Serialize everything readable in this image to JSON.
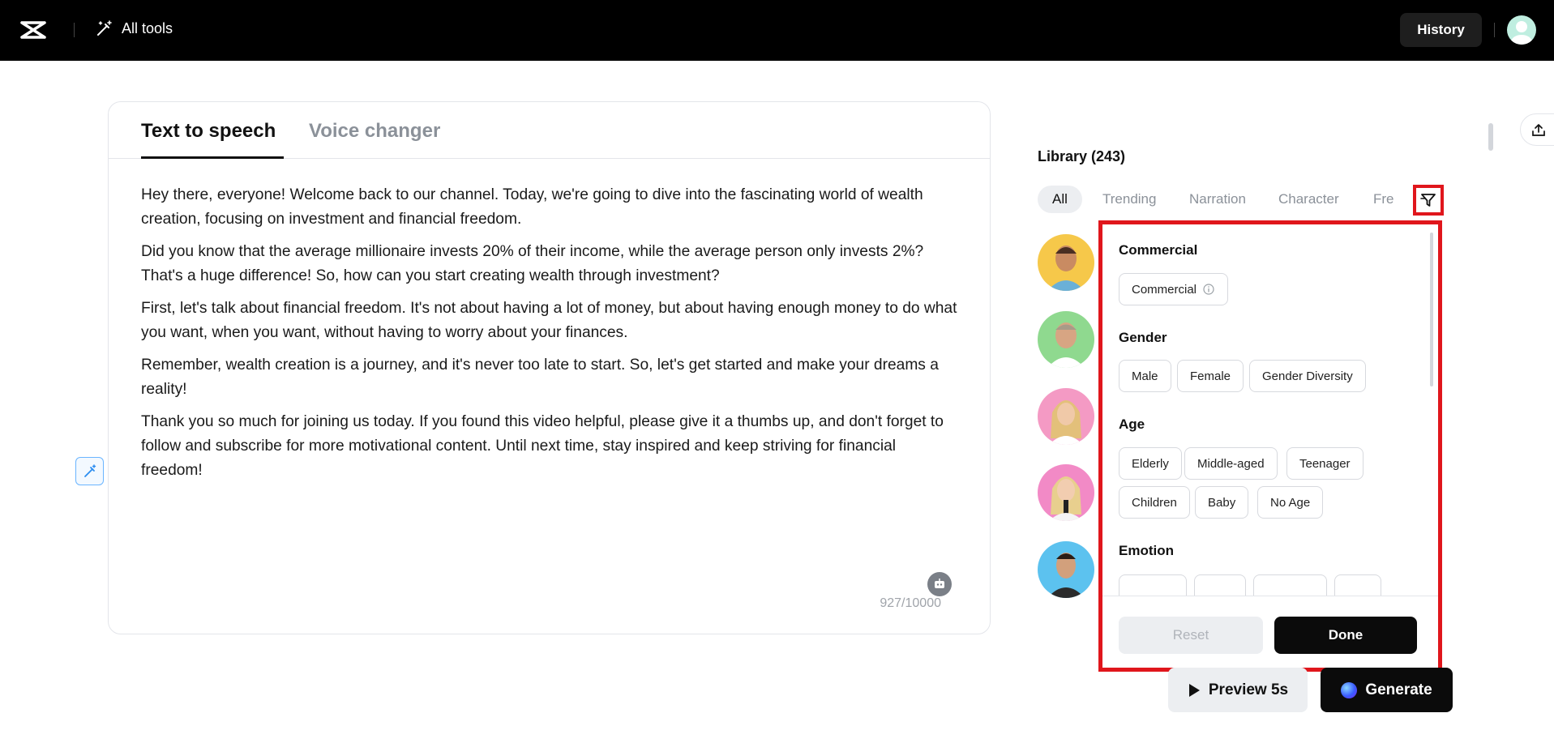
{
  "topbar": {
    "all_tools_label": "All tools",
    "history_label": "History"
  },
  "editor": {
    "tabs": [
      {
        "label": "Text to speech",
        "active": true
      },
      {
        "label": "Voice changer",
        "active": false
      }
    ],
    "paragraphs": [
      "Hey there, everyone! Welcome back to our channel. Today, we're going to dive into the fascinating world of wealth creation, focusing on investment and financial freedom.",
      "Did you know that the average millionaire invests 20% of their income, while the average person only invests 2%? That's a huge difference! So, how can you start creating wealth through investment?",
      "First, let's talk about financial freedom. It's not about having a lot of money, but about having enough money to do what you want, when you want, without having to worry about your finances.",
      "Remember, wealth creation is a journey, and it's never too late to start. So, let's get started and make your dreams a reality!",
      "Thank you so much for joining us today. If you found this video helpful, please give it a thumbs up, and don't forget to follow and subscribe for more motivational content. Until next time, stay inspired and keep striving for financial freedom!"
    ],
    "char_counter": "927/10000"
  },
  "library": {
    "title": "Library (243)",
    "categories": [
      "All",
      "Trending",
      "Narration",
      "Character",
      "Fre"
    ]
  },
  "filter_panel": {
    "sections": [
      {
        "title": "Commercial",
        "chips": [
          "Commercial"
        ]
      },
      {
        "title": "Gender",
        "chips": [
          "Male",
          "Female",
          "Gender Diversity"
        ]
      },
      {
        "title": "Age",
        "chips": [
          "Elderly",
          "Middle-aged",
          "Teenager",
          "Children",
          "Baby",
          "No Age"
        ]
      },
      {
        "title": "Emotion",
        "chips": []
      }
    ],
    "reset_label": "Reset",
    "done_label": "Done"
  },
  "actions": {
    "preview_label": "Preview 5s",
    "generate_label": "Generate"
  },
  "colors": {
    "highlight": "#e0161c",
    "accent": "#0b0b0b"
  }
}
